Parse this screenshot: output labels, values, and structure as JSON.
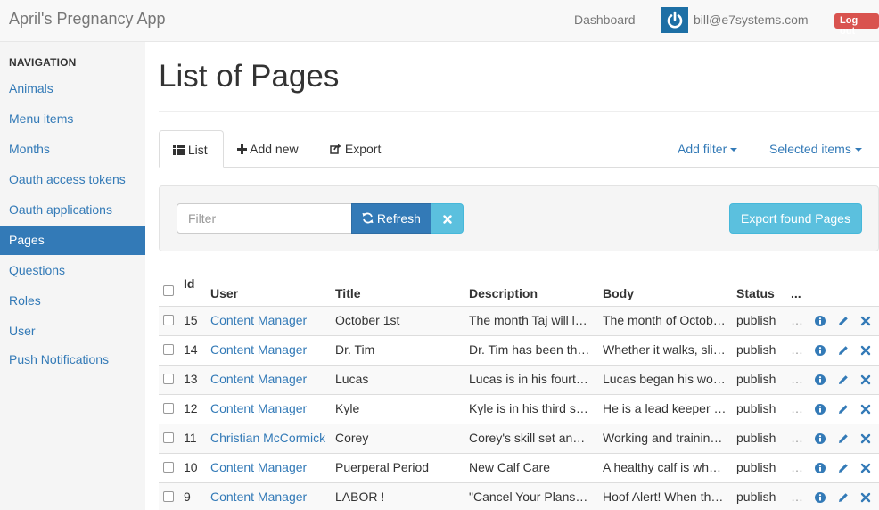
{
  "navbar": {
    "brand": "April's Pregnancy App",
    "dashboard": "Dashboard",
    "user_email": "bill@e7systems.com",
    "logout": "Log out",
    "avatar_icon": "power-icon"
  },
  "sidebar": {
    "header": "NAVIGATION",
    "items": [
      {
        "label": "Animals"
      },
      {
        "label": "Menu items"
      },
      {
        "label": "Months"
      },
      {
        "label": "Oauth access tokens"
      },
      {
        "label": "Oauth applications"
      },
      {
        "label": "Pages",
        "active": true
      },
      {
        "label": "Questions"
      },
      {
        "label": "Roles"
      },
      {
        "label": "User"
      },
      {
        "label": "Push Notifications"
      }
    ]
  },
  "main": {
    "title": "List of Pages",
    "tabs": {
      "list": "List",
      "add_new": "Add new",
      "export": "Export",
      "add_filter": "Add filter",
      "selected_items": "Selected items"
    },
    "filter": {
      "placeholder": "Filter",
      "refresh": "Refresh",
      "clear_icon": "times-icon",
      "export_found": "Export found Pages"
    },
    "table": {
      "columns": [
        "Id",
        "User",
        "Title",
        "Description",
        "Body",
        "Status",
        "..."
      ],
      "rows": [
        {
          "id": "15",
          "user": "Content Manager",
          "title": "October 1st",
          "description": "The month Taj will l…",
          "body": "The month of Octob…",
          "status": "publish",
          "more": "…"
        },
        {
          "id": "14",
          "user": "Content Manager",
          "title": "Dr. Tim",
          "description": "Dr. Tim has been th…",
          "body": "Whether it walks, sli…",
          "status": "publish",
          "more": "…"
        },
        {
          "id": "13",
          "user": "Content Manager",
          "title": "Lucas",
          "description": "Lucas is in his fourt…",
          "body": "Lucas began his wo…",
          "status": "publish",
          "more": "…"
        },
        {
          "id": "12",
          "user": "Content Manager",
          "title": "Kyle",
          "description": "Kyle is in his third s…",
          "body": "He is a lead keeper …",
          "status": "publish",
          "more": "…"
        },
        {
          "id": "11",
          "user": "Christian McCormick",
          "title": "Corey",
          "description": "Corey's skill set and…",
          "body": "Working and trainin…",
          "status": "publish",
          "more": "…"
        },
        {
          "id": "10",
          "user": "Content Manager",
          "title": "Puerperal Period",
          "description": "New Calf Care",
          "body": "A healthy calf is wh…",
          "status": "publish",
          "more": "…"
        },
        {
          "id": "9",
          "user": "Content Manager",
          "title": "LABOR !",
          "description": "\"Cancel Your Plans …",
          "body": "Hoof Alert! When th…",
          "status": "publish",
          "more": "…"
        }
      ],
      "row_actions": [
        "info-icon",
        "pencil-icon",
        "delete-icon"
      ]
    }
  },
  "colors": {
    "primary": "#337ab7",
    "info": "#5bc0de",
    "danger": "#d9534f",
    "sidebar_bg": "#f5f5f5"
  }
}
